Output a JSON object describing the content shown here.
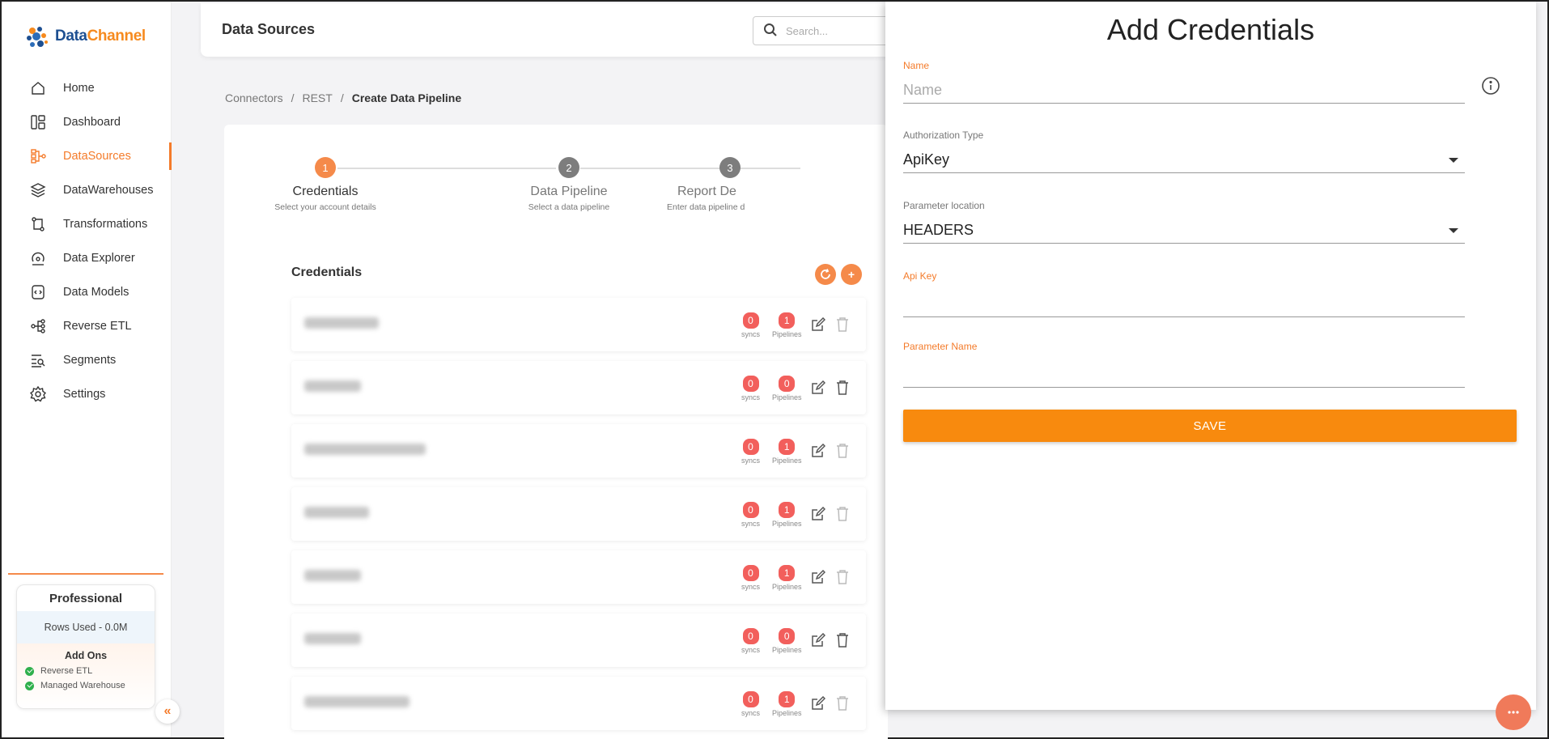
{
  "app": {
    "logo_part1": "Data",
    "logo_part2": "Channel"
  },
  "sidebar": {
    "items": [
      {
        "label": "Home",
        "icon": "home-icon"
      },
      {
        "label": "Dashboard",
        "icon": "dashboard-icon"
      },
      {
        "label": "DataSources",
        "icon": "datasources-icon",
        "active": true
      },
      {
        "label": "DataWarehouses",
        "icon": "datawarehouses-icon"
      },
      {
        "label": "Transformations",
        "icon": "transformations-icon"
      },
      {
        "label": "Data Explorer",
        "icon": "data-explorer-icon"
      },
      {
        "label": "Data Models",
        "icon": "data-models-icon"
      },
      {
        "label": "Reverse ETL",
        "icon": "reverse-etl-icon"
      },
      {
        "label": "Segments",
        "icon": "segments-icon"
      },
      {
        "label": "Settings",
        "icon": "settings-icon"
      }
    ],
    "plan": {
      "title": "Professional",
      "rows_used": "Rows Used - 0.0M",
      "addons_title": "Add Ons",
      "addons": [
        "Reverse ETL",
        "Managed Warehouse"
      ]
    },
    "collapse_glyph": "«"
  },
  "header": {
    "title": "Data Sources",
    "search_placeholder": "Search..."
  },
  "breadcrumb": [
    "Connectors",
    "REST",
    "Create Data Pipeline"
  ],
  "breadcrumb_sep": "/",
  "stepper": [
    {
      "num": "1",
      "label": "Credentials",
      "sub": "Select your account details"
    },
    {
      "num": "2",
      "label": "Data Pipeline",
      "sub": "Select a data pipeline"
    },
    {
      "num": "3",
      "label": "Report De",
      "sub": "Enter data pipeline d"
    }
  ],
  "credentials": {
    "title": "Credentials",
    "add_glyph": "+",
    "sync_label": "syncs",
    "pipeline_label": "Pipelines",
    "rows": [
      {
        "syncs": "0",
        "pipelines": "1"
      },
      {
        "syncs": "0",
        "pipelines": "0"
      },
      {
        "syncs": "0",
        "pipelines": "1"
      },
      {
        "syncs": "0",
        "pipelines": "1"
      },
      {
        "syncs": "0",
        "pipelines": "1"
      },
      {
        "syncs": "0",
        "pipelines": "0"
      },
      {
        "syncs": "0",
        "pipelines": "1"
      }
    ]
  },
  "drawer": {
    "title": "Add Credentials",
    "name_label": "Name",
    "name_placeholder": "Name",
    "auth_label": "Authorization Type",
    "auth_value": "ApiKey",
    "param_loc_label": "Parameter location",
    "param_loc_value": "HEADERS",
    "api_key_label": "Api Key",
    "param_name_label": "Parameter Name",
    "save_label": "SAVE"
  },
  "colors": {
    "accent": "#f47b2a",
    "save": "#f88a0e",
    "badge": "#f25f5c"
  }
}
